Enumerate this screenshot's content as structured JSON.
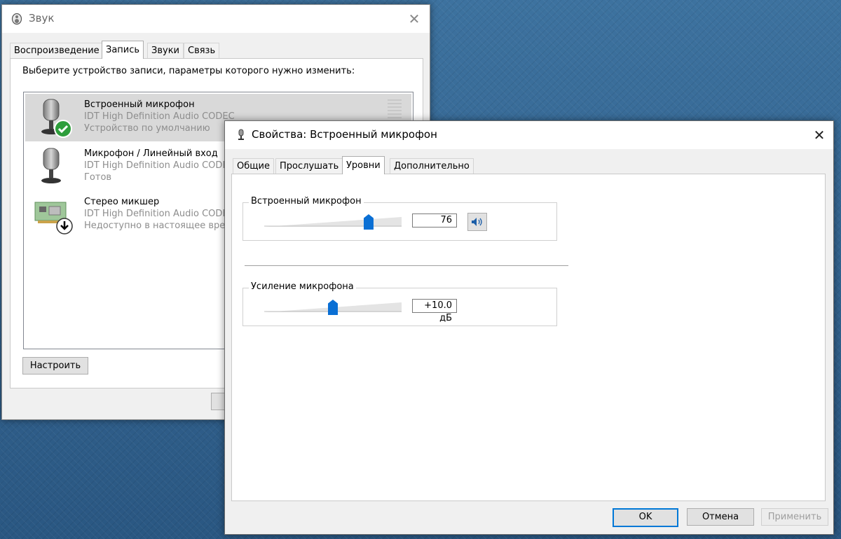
{
  "sound_window": {
    "title": "Звук",
    "tabs": [
      "Воспроизведение",
      "Запись",
      "Звуки",
      "Связь"
    ],
    "active_tab": "Запись",
    "instruction": "Выберите устройство записи, параметры которого нужно изменить:",
    "devices": [
      {
        "name": "Встроенный микрофон",
        "driver": "IDT High Definition Audio CODEC",
        "status": "Устройство по умолчанию",
        "icon": "microphone-default-icon",
        "selected": true
      },
      {
        "name": "Микрофон / Линейный вход",
        "driver": "IDT High Definition Audio CODEC",
        "status": "Готов",
        "icon": "microphone-icon"
      },
      {
        "name": "Стерео микшер",
        "driver": "IDT High Definition Audio CODEC",
        "status": "Недоступно в настоящее время",
        "icon": "sound-card-icon"
      }
    ],
    "configure_button": "Настроить"
  },
  "props_window": {
    "title": "Свойства: Встроенный микрофон",
    "tabs": [
      "Общие",
      "Прослушать",
      "Уровни",
      "Дополнительно"
    ],
    "active_tab": "Уровни",
    "levels": [
      {
        "label": "Встроенный микрофон",
        "value": "76",
        "level": 0.76,
        "has_mute_button": true
      },
      {
        "label": "Усиление микрофона",
        "value": "+10.0 дБ",
        "level": 0.5
      }
    ],
    "buttons": {
      "ok": "OK",
      "cancel": "Отмена",
      "apply": "Применить"
    }
  },
  "colors": {
    "accent": "#0078d7",
    "slider_thumb": "#0a6fd4",
    "selected_row": "#d9d9d9",
    "desktop": "#2f5f88"
  }
}
